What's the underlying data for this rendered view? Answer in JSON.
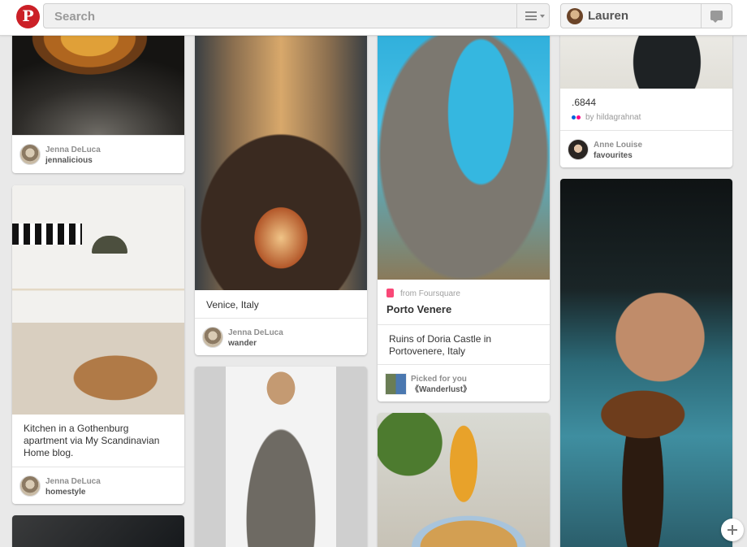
{
  "header": {
    "logo_letter": "P",
    "search_placeholder": "Search",
    "user_name": "Lauren"
  },
  "pins": {
    "tart": {
      "pinner": "Jenna DeLuca",
      "board": "jennalicious"
    },
    "kitchen": {
      "description": "Kitchen in a Gothenburg apartment via My Scandinavian Home blog.",
      "pinner": "Jenna DeLuca",
      "board": "homestyle"
    },
    "venice": {
      "description": "Venice, Italy",
      "pinner": "Jenna DeLuca",
      "board": "wander"
    },
    "porto": {
      "source": "from Foursquare",
      "place_title": "Porto Venere",
      "description": "Ruins of Doria Castle in Portovenere, Italy",
      "picked_label": "Picked for you",
      "picked_board": "《Wanderlust》"
    },
    "girl": {
      "description": ".6844",
      "credit": "by hildagrahnat",
      "pinner": "Anne Louise",
      "board": "favourites"
    }
  },
  "icons": {
    "logo": "pinterest-logo-icon",
    "menu": "menu-icon",
    "notifications": "notifications-icon",
    "add": "add-icon",
    "foursquare": "foursquare-icon",
    "flickr": "flickr-icon"
  },
  "colors": {
    "brand_red": "#cb2027",
    "foursquare_pink": "#f94877",
    "background": "#e9e9e9"
  }
}
